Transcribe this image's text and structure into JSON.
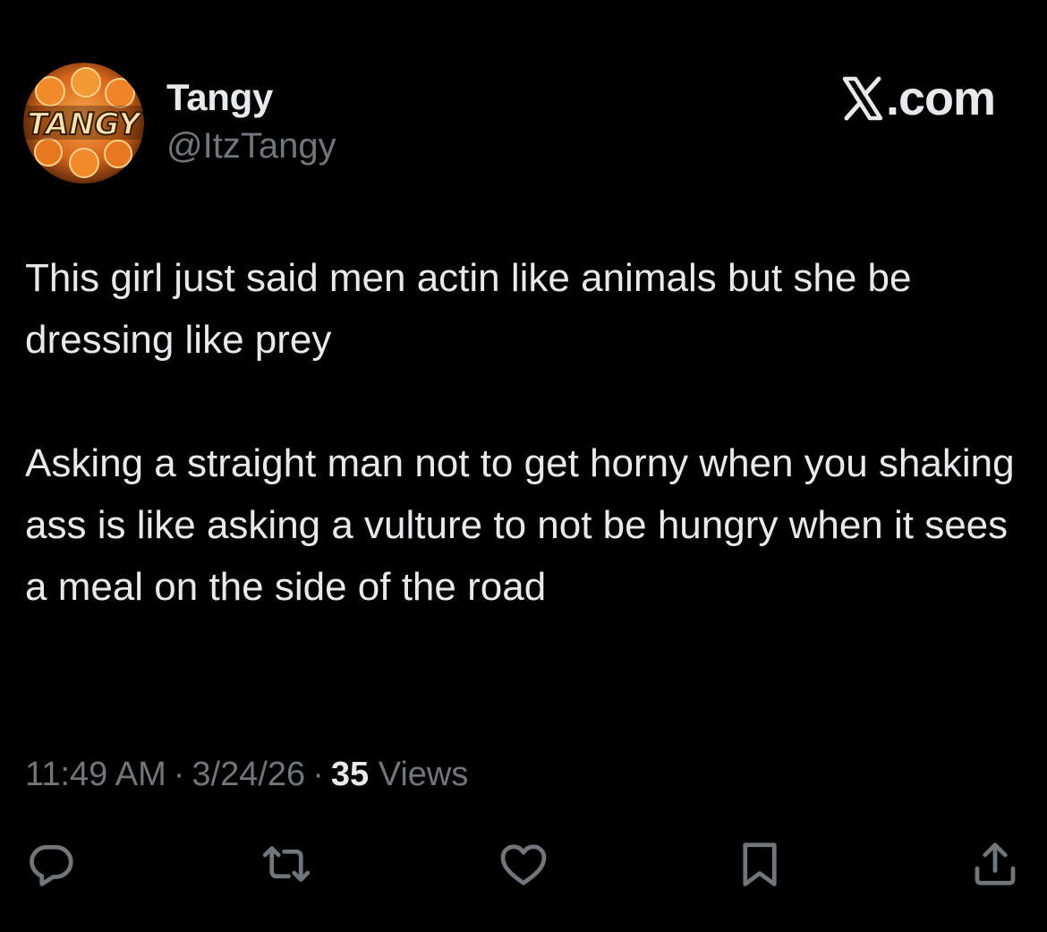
{
  "author": {
    "display_name": "Tangy",
    "handle": "@ItzTangy",
    "avatar_text": "TANGY"
  },
  "brand": {
    "label": ".com",
    "icon": "x-logo-icon"
  },
  "tweet": {
    "text": "This girl just said men actin like animals but she be dressing like prey\n\nAsking a straight man not to get horny when you shaking ass is like asking a vulture to not be hungry when it sees a meal on the side of the road"
  },
  "meta": {
    "time": "11:49 AM",
    "separator": "·",
    "date": "3/24/26",
    "views_count": "35",
    "views_label": "Views"
  },
  "actions": [
    {
      "name": "reply",
      "icon": "reply-icon"
    },
    {
      "name": "retweet",
      "icon": "retweet-icon"
    },
    {
      "name": "like",
      "icon": "heart-icon"
    },
    {
      "name": "bookmark",
      "icon": "bookmark-icon"
    },
    {
      "name": "share",
      "icon": "share-icon"
    }
  ],
  "colors": {
    "background": "#000000",
    "primary_text": "#e7e9ea",
    "secondary_text": "#71767b",
    "avatar_orange": "#e8741c"
  }
}
